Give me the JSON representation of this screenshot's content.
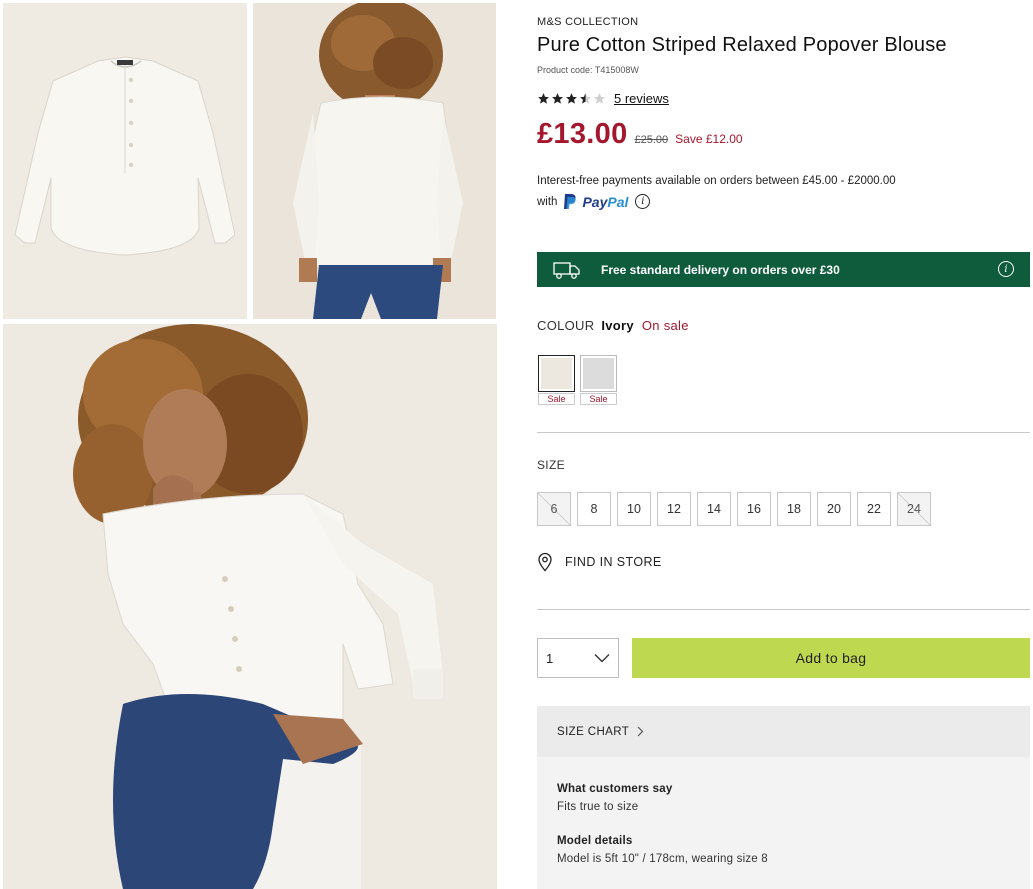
{
  "gallery": {
    "images": [
      {
        "alt": "White blouse flat lay"
      },
      {
        "alt": "Model back view"
      },
      {
        "alt": "Model seated"
      }
    ]
  },
  "product": {
    "brand": "M&S COLLECTION",
    "title": "Pure Cotton Striped Relaxed Popover Blouse",
    "code": "Product code: T415008W",
    "rating": 3.5,
    "reviews_link": "5 reviews",
    "price": "£13.00",
    "was_price": "£25.00",
    "save_text": "Save £12.00",
    "price_color": "#a4172d"
  },
  "payments": {
    "line1": "Interest-free payments available on orders between £45.00 - £2000.00",
    "with": "with",
    "paypal_pay": "Pay",
    "paypal_pal": "Pal",
    "info_glyph": "i"
  },
  "delivery": {
    "text": "Free standard delivery on orders over £30",
    "bg_color": "#0f5c3d",
    "icon": "truck-icon",
    "info_glyph": "i"
  },
  "colour": {
    "label": "COLOUR",
    "value": "Ivory",
    "sale_text": "On sale",
    "swatches": [
      {
        "name": "Ivory",
        "color": "#ece8df",
        "tag": "Sale",
        "selected": true
      },
      {
        "name": "Grey",
        "color": "#dcdcdc",
        "tag": "Sale",
        "selected": false
      }
    ]
  },
  "size": {
    "label": "SIZE",
    "options": [
      {
        "label": "6",
        "available": false
      },
      {
        "label": "8",
        "available": true
      },
      {
        "label": "10",
        "available": true
      },
      {
        "label": "12",
        "available": true
      },
      {
        "label": "14",
        "available": true
      },
      {
        "label": "16",
        "available": true
      },
      {
        "label": "18",
        "available": true
      },
      {
        "label": "20",
        "available": true
      },
      {
        "label": "22",
        "available": true
      },
      {
        "label": "24",
        "available": false
      }
    ]
  },
  "store": {
    "label": "FIND IN STORE",
    "icon": "location-pin-icon"
  },
  "purchase": {
    "quantity": "1",
    "add_to_bag": "Add to bag",
    "button_color": "#bed94f"
  },
  "size_chart": {
    "label": "SIZE CHART"
  },
  "details": {
    "customers_title": "What customers say",
    "customers_text": "Fits true to size",
    "model_title": "Model details",
    "model_text": "Model is 5ft 10\" / 178cm, wearing size 8"
  }
}
